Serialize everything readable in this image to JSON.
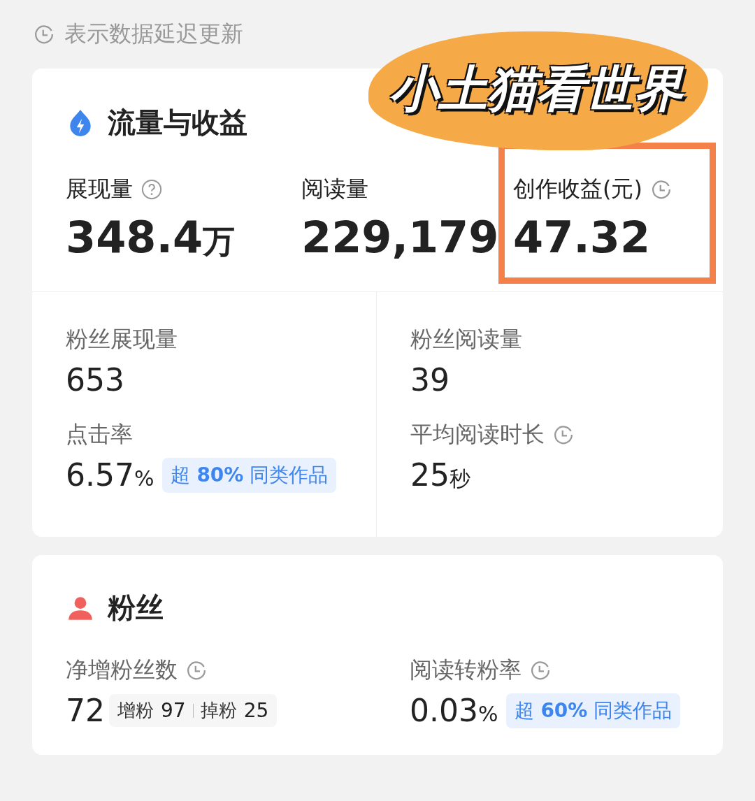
{
  "notice": {
    "text": "表示数据延迟更新"
  },
  "sticker": {
    "text": "小土猫看世界"
  },
  "traffic": {
    "title": "流量与收益",
    "top_metrics": [
      {
        "label": "展现量",
        "kind": "help",
        "value": "348.4",
        "unit": "万",
        "highlighted": false
      },
      {
        "label": "阅读量",
        "value": "229,179",
        "highlighted": false
      },
      {
        "label": "创作收益(元)",
        "kind": "delayed",
        "value": "47.32",
        "highlighted": true
      }
    ],
    "grid_metrics": [
      {
        "label": "粉丝展现量",
        "value": "653"
      },
      {
        "label": "粉丝阅读量",
        "value": "39"
      },
      {
        "label": "点击率",
        "value": "6.57",
        "unit": "%",
        "badge": "超 **80%** 同类作品"
      },
      {
        "label": "平均阅读时长",
        "kind": "delayed",
        "value": "25",
        "unit": "秒"
      }
    ]
  },
  "fans": {
    "title": "粉丝",
    "metrics": [
      {
        "label": "净增粉丝数",
        "kind": "delayed",
        "value": "72",
        "breakdown": [
          {
            "label": "增粉",
            "value": "97"
          },
          {
            "label": "掉粉",
            "value": "25"
          }
        ]
      },
      {
        "label": "阅读转粉率",
        "kind": "delayed",
        "value": "0.03",
        "unit": "%",
        "badge": "超 **60%** 同类作品"
      }
    ]
  }
}
